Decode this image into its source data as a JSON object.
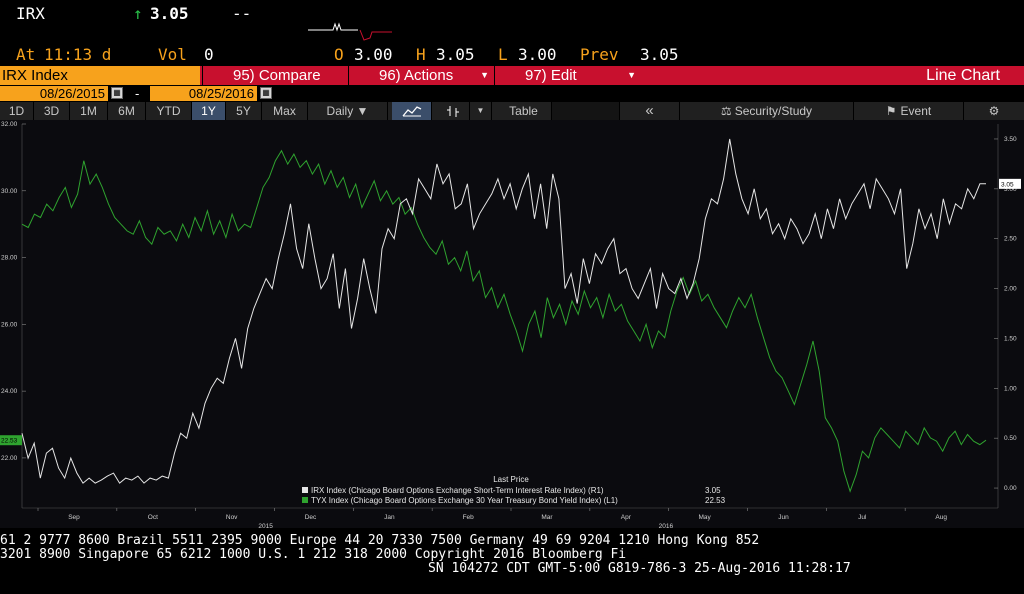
{
  "quote": {
    "ticker": "IRX",
    "last_arrow": "↑",
    "last": "3.05",
    "change": "--",
    "at_label": "At",
    "time": "11:13 d",
    "vol_label": "Vol",
    "vol": "0",
    "open_label": "O",
    "open": "3.00",
    "high_label": "H",
    "high": "3.05",
    "low_label": "L",
    "low": "3.00",
    "prev_label": "Prev",
    "prev": "3.05"
  },
  "command_bar": {
    "security": "IRX Index",
    "compare": "95) Compare",
    "actions": "96) Actions",
    "edit": "97) Edit",
    "chart_title": "Line Chart"
  },
  "dates": {
    "start": "08/26/2015",
    "separator": "-",
    "end": "08/25/2016"
  },
  "toolbar": {
    "ranges": [
      "1D",
      "3D",
      "1M",
      "6M",
      "YTD",
      "1Y",
      "5Y",
      "Max"
    ],
    "active_range": "1Y",
    "frequency": "Daily ▼",
    "table": "Table",
    "back": "«",
    "security_study": "Security/Study",
    "event": "Event",
    "settings": "⚙"
  },
  "chart_data": {
    "type": "line",
    "left_axis": {
      "ticks": [
        "32.00",
        "30.00",
        "28.00",
        "26.00",
        "24.00",
        "22.00"
      ],
      "ylim": [
        20.5,
        32
      ]
    },
    "right_axis": {
      "ticks": [
        "3.50",
        "3.00",
        "2.50",
        "2.00",
        "1.50",
        "1.00",
        "0.50",
        "0.00"
      ],
      "ylim": [
        -0.2,
        3.65
      ]
    },
    "x_ticks": [
      "Sep",
      "Oct",
      "Nov",
      "Dec",
      "Jan",
      "Feb",
      "Mar",
      "Apr",
      "May",
      "Jun",
      "Jul",
      "Aug"
    ],
    "year_labels": [
      "2015",
      "2016"
    ],
    "legend_title": "Last Price",
    "series": [
      {
        "name": "IRX Index (Chicago Board Options Exchange Short-Term Interest Rate Index)  (R1)",
        "last": "3.05",
        "axis": "right",
        "color": "#e6e6e6",
        "values": [
          0.55,
          0.3,
          0.45,
          0.1,
          0.35,
          0.4,
          0.2,
          0.1,
          0.3,
          0.15,
          0.05,
          0.1,
          0.05,
          0.08,
          0.12,
          0.15,
          0.05,
          0.1,
          0.08,
          0.12,
          0.05,
          0.1,
          0.08,
          0.12,
          0.1,
          0.35,
          0.55,
          0.5,
          0.75,
          0.6,
          0.85,
          1.0,
          1.1,
          1.05,
          1.3,
          1.5,
          1.2,
          1.6,
          1.8,
          1.95,
          2.1,
          2.0,
          2.3,
          2.55,
          2.85,
          2.4,
          2.2,
          2.65,
          2.3,
          2.0,
          2.1,
          2.35,
          1.8,
          2.2,
          1.6,
          1.9,
          2.3,
          2.0,
          1.75,
          2.4,
          2.6,
          2.5,
          2.85,
          2.9,
          2.75,
          3.1,
          3.0,
          2.9,
          3.25,
          3.05,
          3.15,
          2.8,
          2.85,
          3.05,
          2.6,
          2.75,
          2.85,
          2.95,
          3.1,
          2.9,
          3.05,
          2.8,
          3.0,
          3.15,
          2.7,
          3.05,
          2.6,
          3.15,
          2.9,
          2.0,
          2.15,
          1.85,
          2.3,
          2.05,
          2.35,
          2.25,
          2.4,
          2.5,
          2.15,
          2.2,
          2.0,
          1.9,
          2.05,
          2.2,
          1.8,
          2.15,
          2.0,
          1.95,
          2.1,
          1.9,
          2.05,
          2.3,
          2.7,
          2.9,
          2.85,
          3.1,
          3.5,
          3.15,
          2.9,
          2.75,
          3.0,
          2.7,
          2.8,
          2.55,
          2.65,
          2.5,
          2.7,
          2.6,
          2.45,
          2.55,
          2.75,
          2.5,
          2.8,
          2.6,
          2.9,
          2.7,
          2.85,
          2.95,
          3.05,
          2.8,
          3.1,
          3.0,
          2.9,
          2.75,
          3.0,
          2.2,
          2.45,
          2.8,
          2.6,
          2.75,
          2.5,
          2.9,
          2.65,
          2.85,
          2.8,
          3.0,
          2.9,
          3.05,
          3.05
        ]
      },
      {
        "name": "TYX Index (Chicago Board Options Exchange 30 Year Treasury Bond Yield Index)  (L1)",
        "last": "22.53",
        "axis": "left",
        "color": "#2fa32f",
        "values": [
          29.0,
          28.9,
          29.3,
          29.2,
          29.6,
          29.4,
          29.8,
          30.1,
          29.5,
          29.9,
          30.9,
          30.2,
          30.5,
          30.1,
          29.6,
          29.2,
          29.0,
          28.8,
          28.7,
          29.1,
          28.6,
          28.4,
          28.9,
          28.7,
          28.8,
          28.5,
          29.0,
          28.6,
          29.2,
          28.8,
          29.4,
          28.7,
          29.1,
          28.6,
          29.3,
          28.8,
          29.0,
          28.9,
          29.5,
          30.1,
          30.4,
          30.9,
          31.2,
          30.8,
          31.1,
          30.7,
          30.9,
          30.5,
          30.8,
          30.2,
          30.6,
          30.1,
          30.4,
          29.8,
          30.2,
          29.5,
          29.9,
          30.3,
          29.7,
          30.0,
          29.6,
          29.8,
          29.3,
          29.5,
          29.0,
          28.6,
          28.3,
          28.1,
          28.5,
          27.8,
          28.0,
          27.6,
          28.2,
          27.3,
          27.6,
          26.8,
          27.1,
          26.5,
          26.9,
          26.3,
          25.8,
          25.2,
          26.0,
          26.4,
          25.6,
          26.8,
          26.2,
          26.6,
          26.0,
          26.7,
          26.3,
          27.0,
          26.5,
          26.8,
          26.2,
          26.9,
          26.4,
          26.6,
          26.1,
          25.8,
          25.5,
          26.0,
          25.3,
          25.8,
          25.6,
          26.4,
          27.0,
          27.4,
          26.9,
          27.3,
          26.7,
          26.9,
          26.5,
          26.2,
          25.9,
          26.4,
          26.8,
          26.5,
          26.9,
          26.2,
          25.6,
          25.0,
          24.6,
          24.4,
          24.0,
          23.6,
          24.2,
          24.8,
          25.5,
          24.6,
          23.2,
          22.9,
          22.5,
          21.6,
          21.0,
          21.5,
          22.2,
          22.0,
          22.6,
          22.9,
          22.7,
          22.5,
          22.3,
          22.8,
          22.6,
          22.4,
          22.9,
          22.6,
          22.5,
          22.2,
          22.6,
          22.8,
          22.4,
          22.7,
          22.5,
          22.4,
          22.53
        ]
      }
    ]
  },
  "footer": {
    "line1": "61 2 9777 8600 Brazil 5511 2395 9000 Europe 44 20 7330 7500 Germany 49 69 9204 1210 Hong Kong 852",
    "line2": "3201 8900        Singapore 65 6212 1000        U.S. 1 212 318 2000        Copyright 2016 Bloomberg Fi",
    "line3": "SN 104272 CDT  GMT-5:00 G819-786-3 25-Aug-2016 11:28:17"
  },
  "colors": {
    "accent_orange": "#f7a21c",
    "command_red": "#c8102e",
    "up_green": "#29c24a",
    "toolbar_active": "#3b4e6a"
  }
}
